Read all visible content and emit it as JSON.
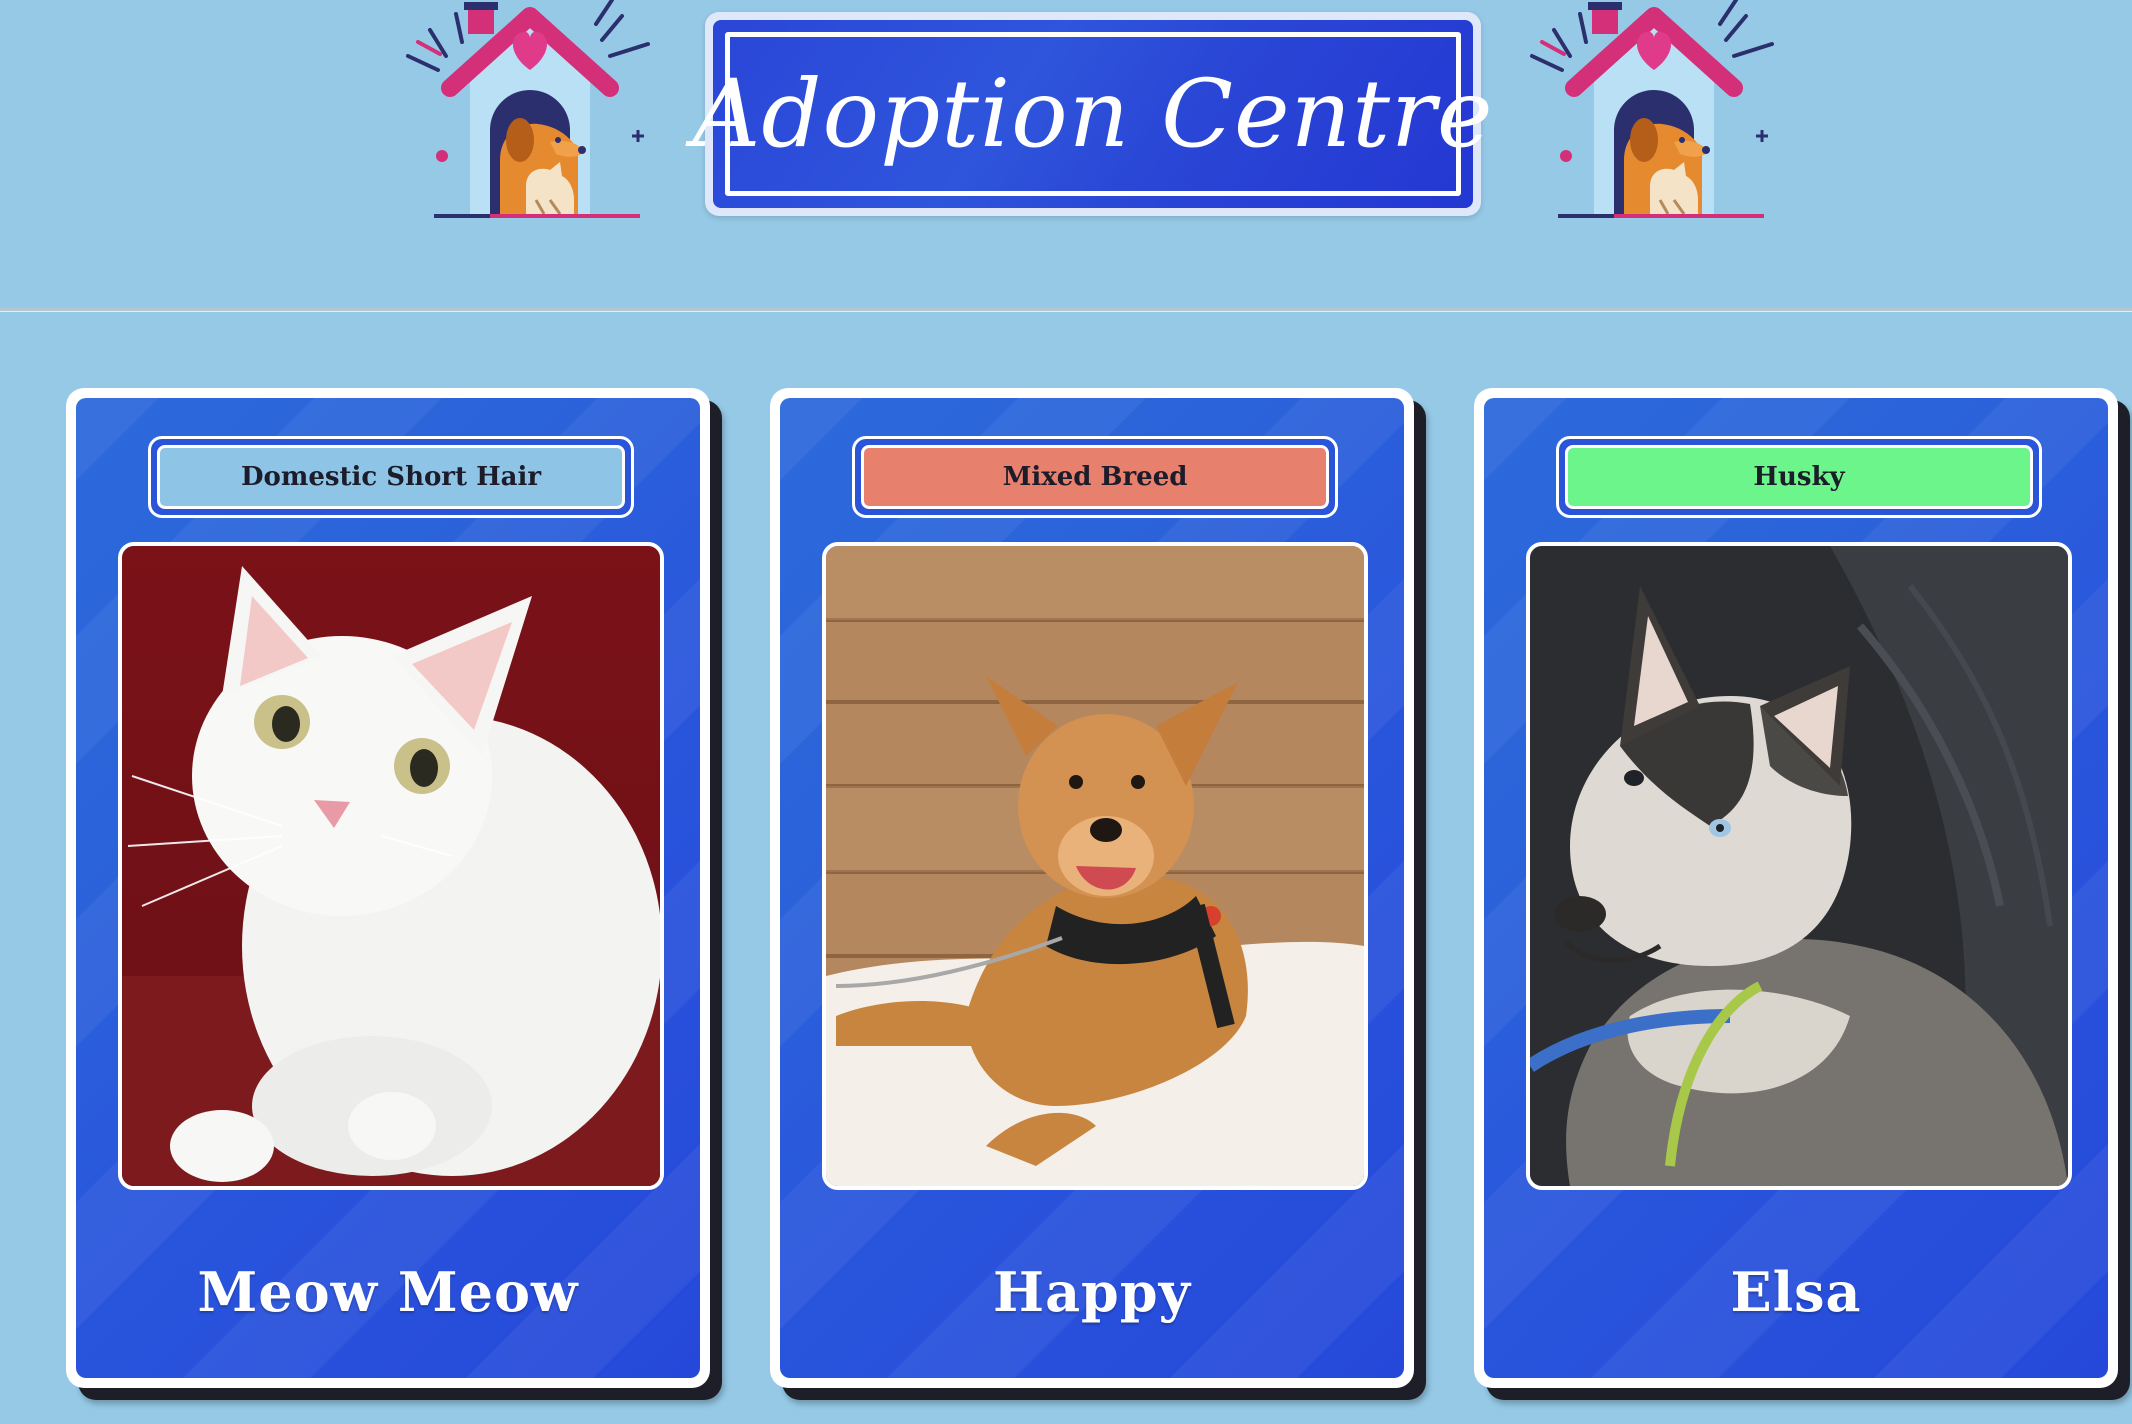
{
  "header": {
    "title": "Adoption Centre",
    "house_icon_left": "dog-house-icon",
    "house_icon_right": "dog-house-icon"
  },
  "colors": {
    "page_background": "#95c9e6",
    "card_blue": "#2a55d8",
    "title_blue": "#2a46d8"
  },
  "pets": [
    {
      "breed": "Domestic Short Hair",
      "breed_color": "#8ec5e6",
      "name": "Meow Meow",
      "photo": "white-cat-photo"
    },
    {
      "breed": "Mixed Breed",
      "breed_color": "#e8806e",
      "name": "Happy",
      "photo": "tan-dog-photo"
    },
    {
      "breed": "Husky",
      "breed_color": "#6cf58a",
      "name": "Elsa",
      "photo": "husky-photo"
    }
  ]
}
